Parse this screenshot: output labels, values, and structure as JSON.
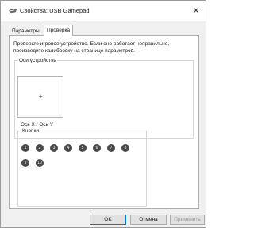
{
  "window": {
    "title": "Свойства: USB Gamepad",
    "icon": "gamepad-icon",
    "close_glyph": "✕"
  },
  "tabs": [
    {
      "label": "Параметры",
      "active": false
    },
    {
      "label": "Проверка",
      "active": true
    }
  ],
  "panel": {
    "description": "Проверьте игровое устройство. Если оно работает неправильно, произведите калибровку на странице параметров.",
    "axes": {
      "group_title": "Оси устройства",
      "crosshair": "+",
      "axis_label": "Ось X / Ось Y"
    },
    "buttons": {
      "group_title": "Кнопки",
      "items": [
        "1",
        "2",
        "3",
        "4",
        "5",
        "6",
        "7",
        "8",
        "9",
        "10"
      ]
    }
  },
  "footer": {
    "ok_label": "OK",
    "cancel_label": "Отмена",
    "apply_label": "Применить"
  }
}
